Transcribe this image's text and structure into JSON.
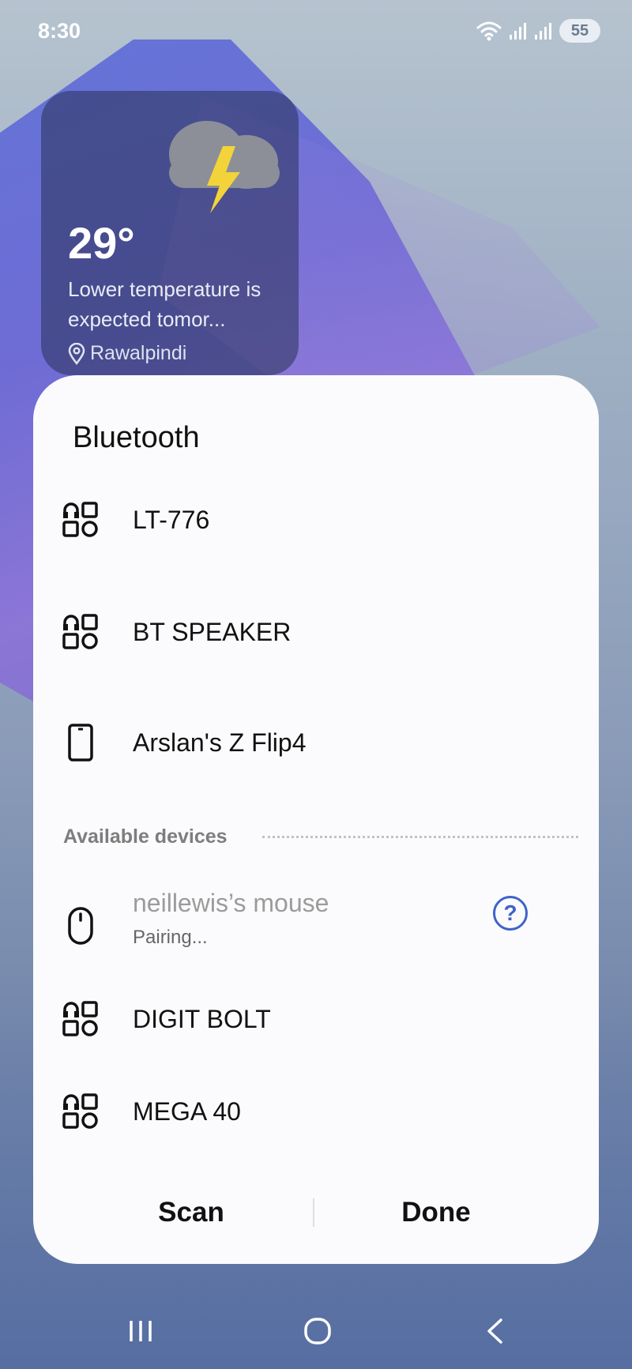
{
  "status_bar": {
    "time": "8:30",
    "battery": "55"
  },
  "weather": {
    "temperature": "29°",
    "description": "Lower temperature is expected tomor...",
    "location": "Rawalpindi",
    "icon": "thunderstorm-icon"
  },
  "bluetooth": {
    "title": "Bluetooth",
    "paired_devices": [
      {
        "name": "LT-776",
        "icon": "generic-device-icon"
      },
      {
        "name": "BT SPEAKER",
        "icon": "generic-device-icon"
      },
      {
        "name": "Arslan's Z Flip4",
        "icon": "phone-icon"
      }
    ],
    "available_label": "Available devices",
    "pairing_device": {
      "name": "neillewis’s mouse",
      "status": "Pairing...",
      "icon": "mouse-icon",
      "help": "?"
    },
    "available_devices": [
      {
        "name": "DIGIT BOLT",
        "icon": "generic-device-icon"
      },
      {
        "name": "MEGA 40",
        "icon": "generic-device-icon"
      }
    ],
    "scan_label": "Scan",
    "done_label": "Done"
  },
  "colors": {
    "accent": "#3f63c9",
    "sheet_bg": "#fbfbfd"
  }
}
